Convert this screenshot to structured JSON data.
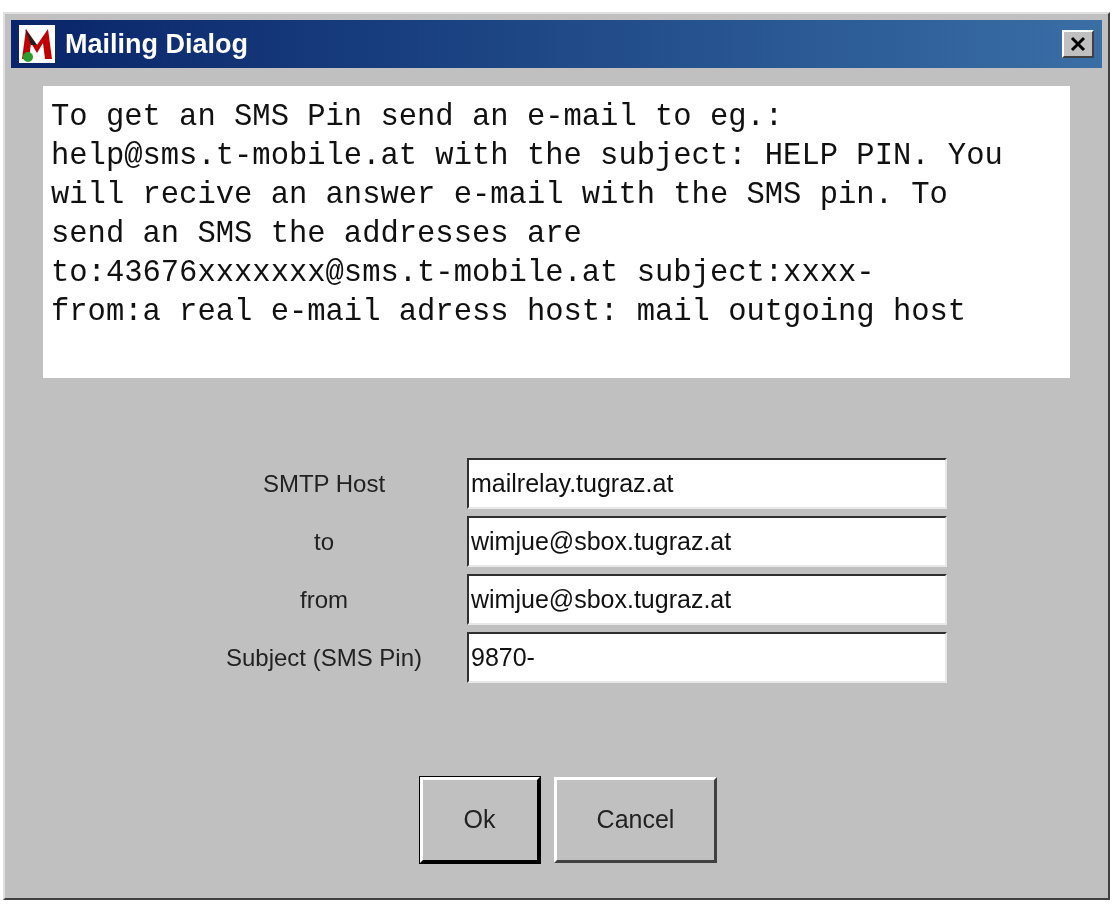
{
  "window": {
    "title": "Mailing Dialog"
  },
  "info_lines": [
    "To get an SMS Pin send an e-mail to eg.:",
    "help@sms.t-mobile.at with the subject: HELP PIN. You",
    "will recive an answer e-mail with the SMS pin. To",
    "send an SMS the addresses are",
    "to:43676xxxxxxx@sms.t-mobile.at subject:xxxx-",
    "from:a real e-mail adress host: mail outgoing host"
  ],
  "fields": [
    {
      "label": "SMTP Host",
      "value": "mailrelay.tugraz.at"
    },
    {
      "label": "to",
      "value": "wimjue@sbox.tugraz.at"
    },
    {
      "label": "from",
      "value": "wimjue@sbox.tugraz.at"
    },
    {
      "label": "Subject (SMS Pin)",
      "value": "9870-"
    }
  ],
  "buttons": [
    {
      "label": "Ok",
      "default": true
    },
    {
      "label": "Cancel",
      "default": false
    }
  ]
}
